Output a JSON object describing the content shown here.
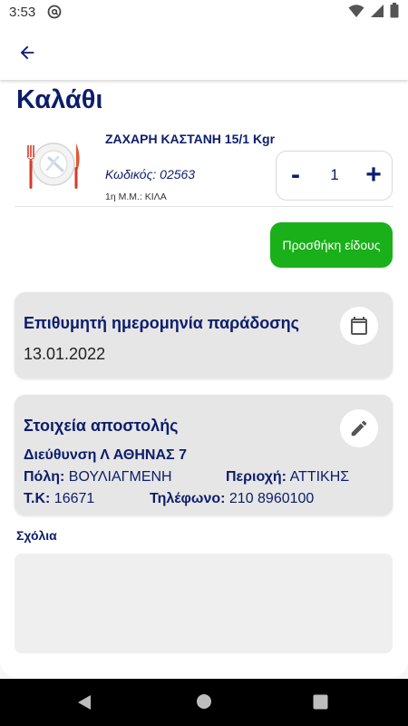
{
  "status_bar": {
    "time": "3:53",
    "left_icon": "vpn-at-icon",
    "right_icons": [
      "wifi-icon",
      "signal-icon",
      "battery-icon"
    ]
  },
  "app_bar": {
    "back_icon": "arrow-back-icon"
  },
  "page": {
    "title": "Καλάθι"
  },
  "cart_item": {
    "image_icon": "plate-cutlery-icon",
    "name": "ΖΑΧΑΡΗ ΚΑΣΤΑΝΗ 15/1 Kgr",
    "code": "Κωδικός: 02563",
    "unit": "1η Μ.Μ.: ΚΙΛΑ",
    "quantity": "1",
    "minus_label": "-",
    "plus_label": "+"
  },
  "add_item_button": "Προσθήκη είδους",
  "delivery_date": {
    "title": "Επιθυμητή ημερομηνία παράδοσης",
    "value": "13.01.2022",
    "icon": "calendar-icon"
  },
  "shipping": {
    "title": "Στοιχεία αποστολής",
    "icon": "edit-pencil-icon",
    "address": "Διεύθυνση Λ ΑΘΗΝΑΣ 7",
    "city_label": "Πόλη:",
    "city_value": "ΒΟΥΛΙΑΓΜΕΝΗ",
    "region_label": "Περιοχή:",
    "region_value": "ΑΤΤΙΚΗΣ",
    "zip_label": "Τ.Κ:",
    "zip_value": "16671",
    "phone_label": "Τηλέφωνο:",
    "phone_value": "210 8960100"
  },
  "comments": {
    "label": "Σχόλια",
    "value": ""
  },
  "colors": {
    "primary_navy": "#0d1d6b",
    "add_button_green": "#1ab01a",
    "card_gray": "#e6e6e6"
  },
  "nav_bar": {
    "icons": [
      "nav-back-icon",
      "nav-home-icon",
      "nav-recents-icon"
    ]
  }
}
